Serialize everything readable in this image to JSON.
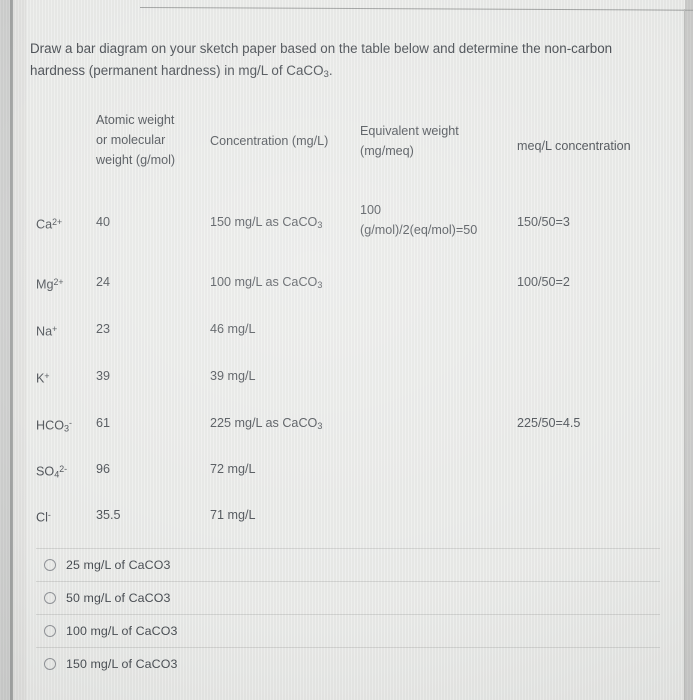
{
  "question": {
    "line1": "Draw a bar diagram on your sketch paper based on the table below and determine the non-carbon",
    "line2_pre": "hardness (permanent hardness) in mg/L of CaCO",
    "line2_sub": "3",
    "line2_post": "."
  },
  "table": {
    "headers": {
      "ion": "",
      "atomic_weight": "Atomic weight\nor molecular\nweight (g/mol)",
      "concentration": "Concentration (mg/L)",
      "equivalent_weight": "Equivalent weight\n(mg/meq)",
      "meq": "meq/L concentration"
    },
    "rows": [
      {
        "ion_base": "Ca",
        "ion_sup": "2+",
        "ion_sub": "",
        "atomic_weight": "40",
        "concentration_pre": "150 mg/L as CaCO",
        "concentration_sub": "3",
        "equivalent_weight": "100\n(g/mol)/2(eq/mol)=50",
        "meq": "150/50=3"
      },
      {
        "ion_base": "Mg",
        "ion_sup": "2+",
        "ion_sub": "",
        "atomic_weight": "24",
        "concentration_pre": "100 mg/L as CaCO",
        "concentration_sub": "3",
        "equivalent_weight": "",
        "meq": "100/50=2"
      },
      {
        "ion_base": "Na",
        "ion_sup": "+",
        "ion_sub": "",
        "atomic_weight": "23",
        "concentration_pre": "46 mg/L",
        "concentration_sub": "",
        "equivalent_weight": "",
        "meq": ""
      },
      {
        "ion_base": "K",
        "ion_sup": "+",
        "ion_sub": "",
        "atomic_weight": "39",
        "concentration_pre": "39 mg/L",
        "concentration_sub": "",
        "equivalent_weight": "",
        "meq": ""
      },
      {
        "ion_base": "HCO",
        "ion_sup": "-",
        "ion_sub": "3",
        "atomic_weight": "61",
        "concentration_pre": "225 mg/L as CaCO",
        "concentration_sub": "3",
        "equivalent_weight": "",
        "meq": "225/50=4.5"
      },
      {
        "ion_base": "SO",
        "ion_sup": "2-",
        "ion_sub": "4",
        "atomic_weight": "96",
        "concentration_pre": "72 mg/L",
        "concentration_sub": "",
        "equivalent_weight": "",
        "meq": ""
      },
      {
        "ion_base": "Cl",
        "ion_sup": "-",
        "ion_sub": "",
        "atomic_weight": "35.5",
        "concentration_pre": "71 mg/L",
        "concentration_sub": "",
        "equivalent_weight": "",
        "meq": ""
      }
    ]
  },
  "answer_options": [
    {
      "label": "25 mg/L of CaCO3",
      "selected": false
    },
    {
      "label": "50 mg/L of CaCO3",
      "selected": false
    },
    {
      "label": "100 mg/L of CaCO3",
      "selected": false
    },
    {
      "label": "150 mg/L of CaCO3",
      "selected": false
    }
  ],
  "colors": {
    "background": "#edeeec",
    "text": "#44494f",
    "separator": "#d2d3d1",
    "radio_border": "#8d9095"
  }
}
